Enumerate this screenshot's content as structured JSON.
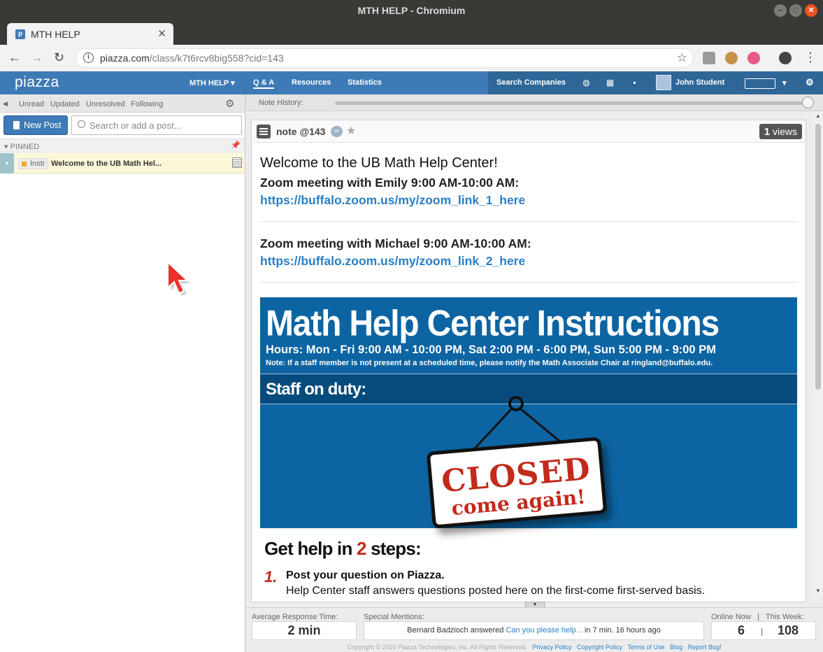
{
  "window": {
    "title": "MTH HELP - Chromium"
  },
  "browser": {
    "tab_title": "MTH HELP",
    "url_host": "piazza.com",
    "url_path": "/class/k7t6rcv8big558?cid=143"
  },
  "piazza_nav": {
    "logo": "piazza",
    "class_menu": "MTH HELP",
    "qa": "Q & A",
    "resources": "Resources",
    "statistics": "Statistics",
    "search_companies": "Search Companies",
    "user_name": "John Student"
  },
  "left_pane": {
    "filters": [
      "Unread",
      "Updated",
      "Unresolved",
      "Following"
    ],
    "new_post": "New Post",
    "search_placeholder": "Search or add a post...",
    "pinned_label": "PINNED",
    "post": {
      "tag": "Instr",
      "title": "Welcome to the UB Math Hel..."
    }
  },
  "note_history_label": "Note History:",
  "note": {
    "label": "note @143",
    "views_count": "1",
    "views_label": "views",
    "headline": "Welcome to the UB Math Help Center!",
    "zoom1_title": "Zoom meeting with Emily 9:00 AM-10:00 AM:",
    "zoom1_link": "https://buffalo.zoom.us/my/zoom_link_1_here",
    "zoom2_title": "Zoom meeting with Michael 9:00 AM-10:00 AM:",
    "zoom2_link": "https://buffalo.zoom.us/my/zoom_link_2_here",
    "banner": {
      "title": "Math Help Center Instructions",
      "hours": "Hours:  Mon - Fri 9:00 AM - 10:00 PM, Sat 2:00 PM - 6:00 PM, Sun 5:00 PM - 9:00 PM",
      "note": "Note:  If a staff member is not present at a scheduled time, please notify the Math Associate Chair at  ringland@buffalo.edu.",
      "staff": "Staff on duty:",
      "sign_line1": "CLOSED",
      "sign_line2": "come again!"
    },
    "steps_pre": "Get help in ",
    "steps_num": "2",
    "steps_post": " steps:",
    "step1_num": "1.",
    "step1_title": "Post your question on Piazza.",
    "step1_desc": "Help Center staff answers questions posted here on the first-come first-served basis."
  },
  "footer": {
    "avg_label": "Average Response Time:",
    "avg_value": "2 min",
    "mentions_label": "Special Mentions:",
    "mention_user": "Bernard Badzioch answered",
    "mention_link": "Can you please help...",
    "mention_time": "in 7 min. 16 hours ago",
    "online_label": "Online Now",
    "week_label": "This Week:",
    "online_value": "6",
    "week_value": "108",
    "copyright": "Copyright © 2020 Piazza Technologies, Inc. All Rights Reserved.",
    "links": [
      "Privacy Policy",
      "Copyright Policy",
      "Terms of Use",
      "Blog",
      "Report Bug!"
    ]
  },
  "colors": {
    "piazza_blue": "#3e7ab5",
    "banner_blue": "#0d64a2",
    "sign_red": "#c22a1b",
    "link_blue": "#2b80c5"
  }
}
